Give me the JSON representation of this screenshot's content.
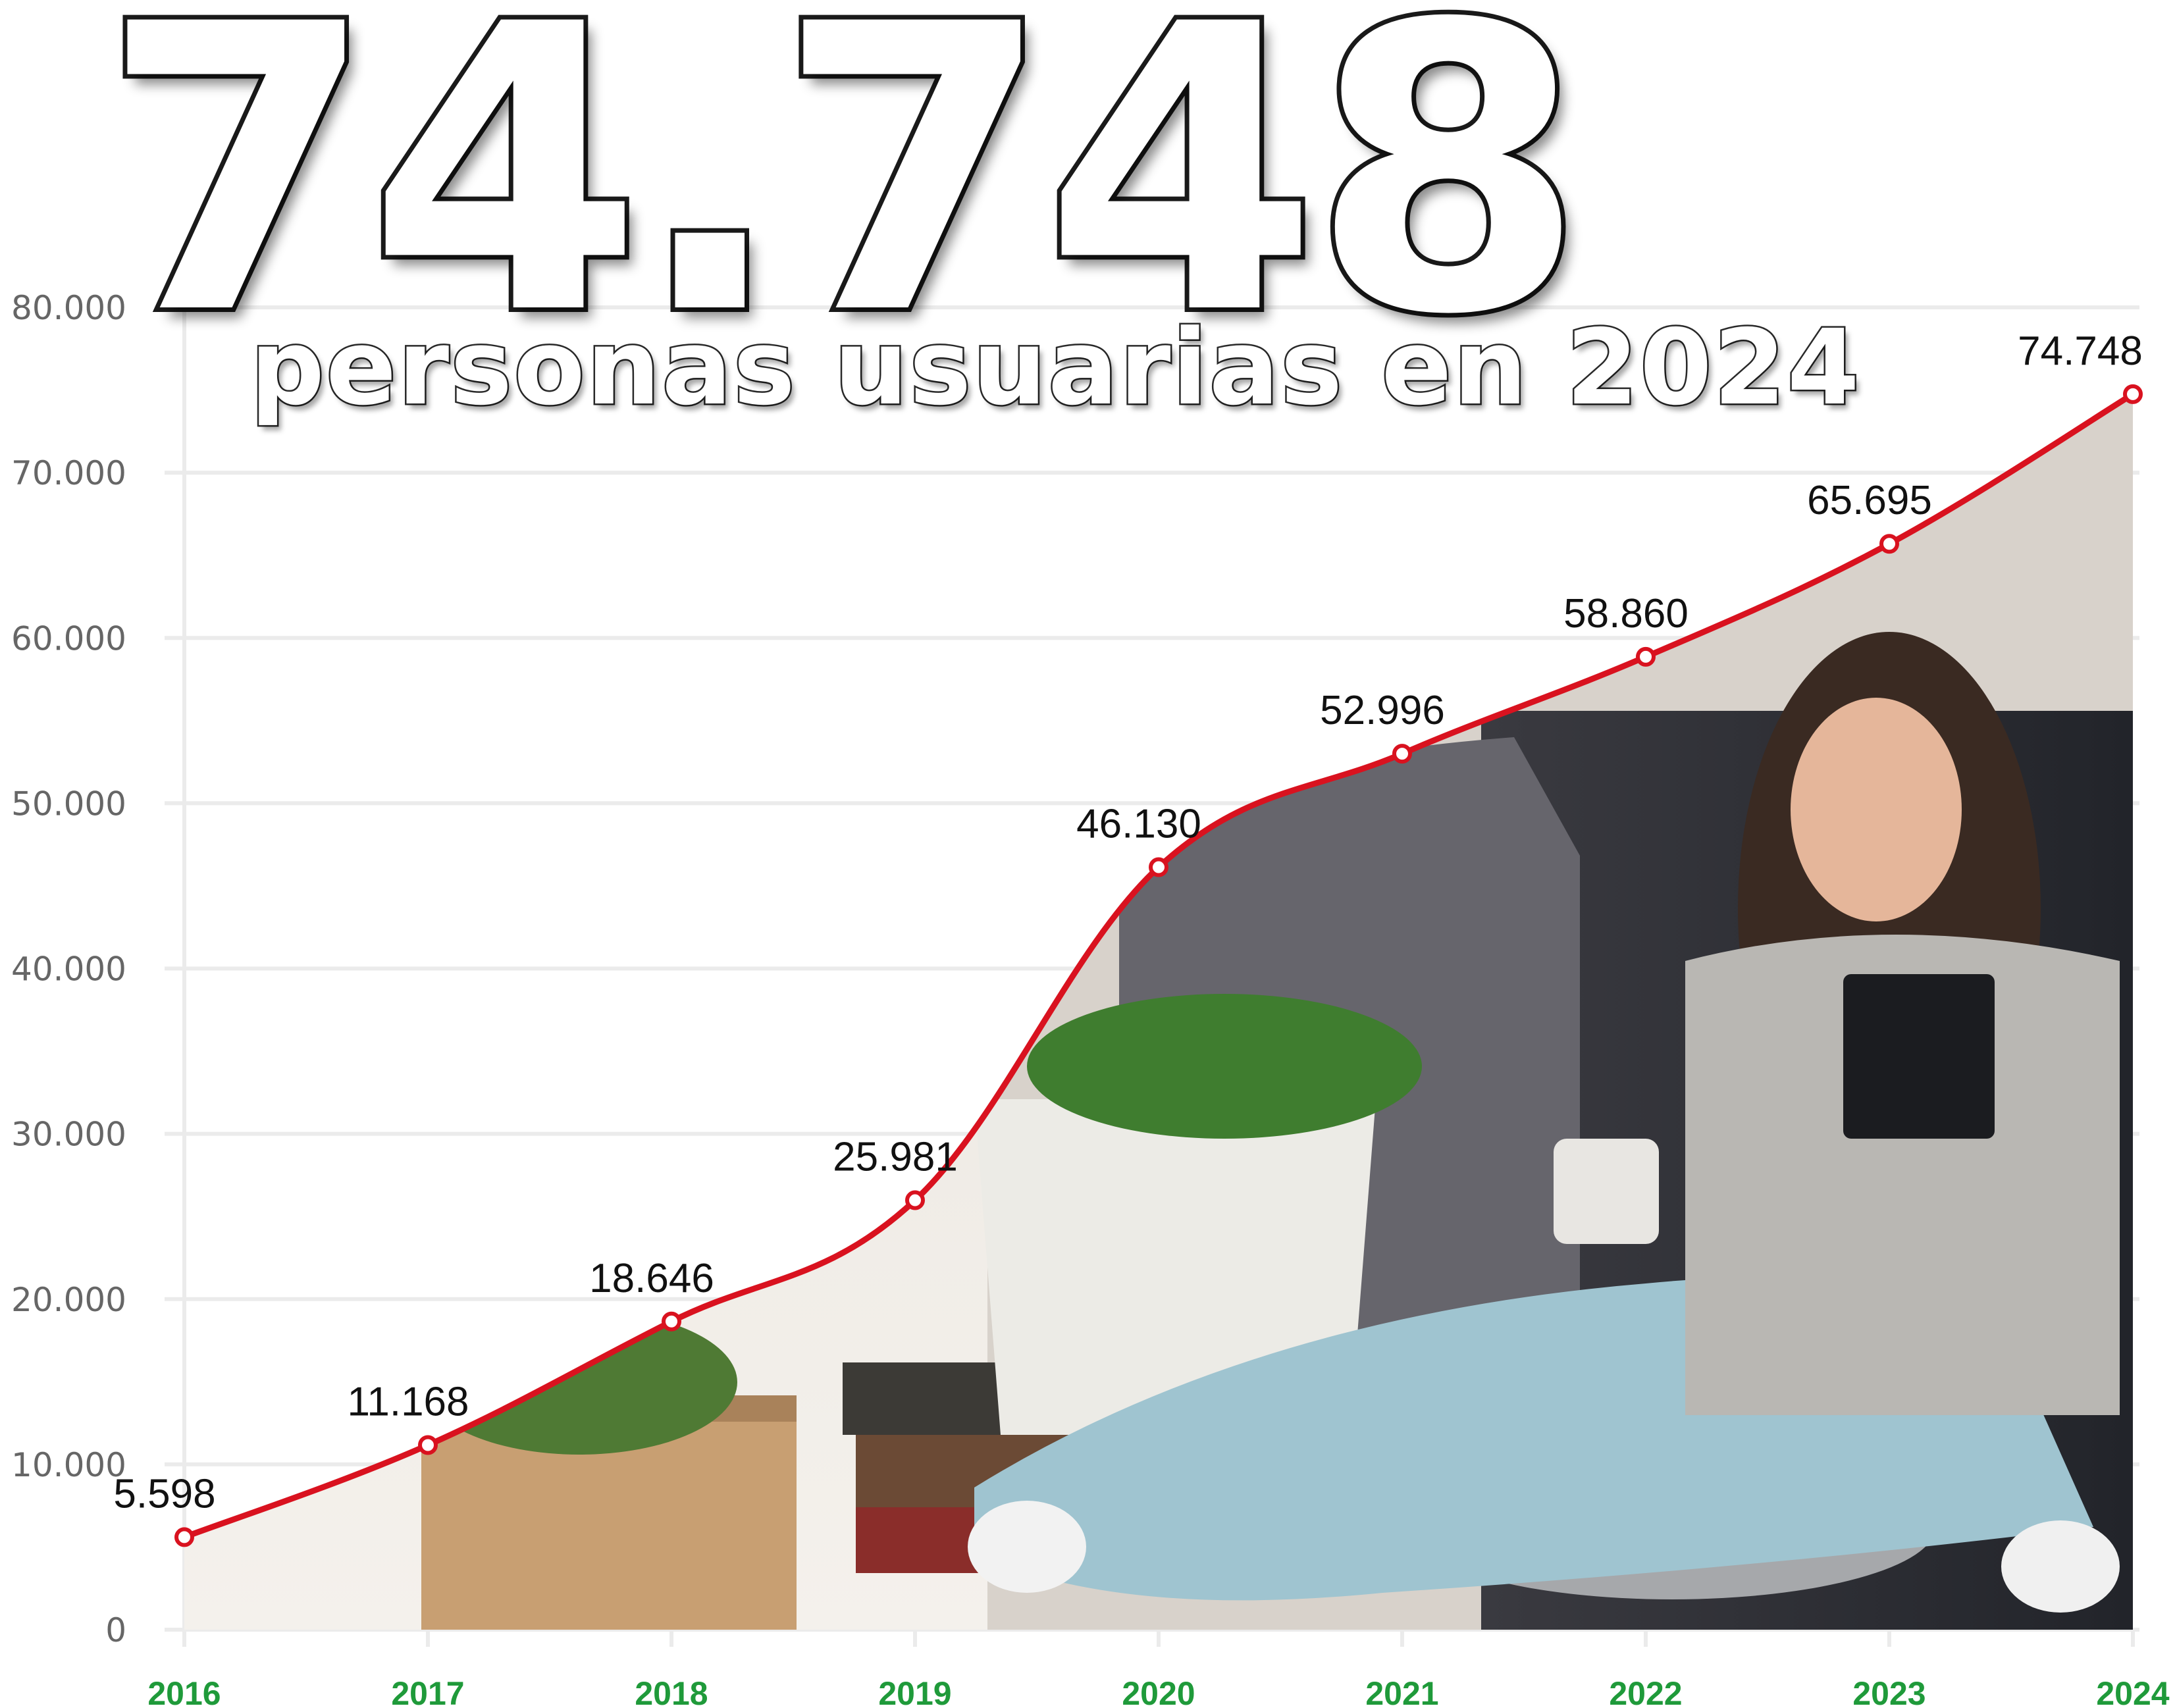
{
  "headline": {
    "number": "74.748",
    "subtitle": "personas usuarias en 2024"
  },
  "colors": {
    "line": "#d9121f",
    "x_tick": "#1f9a3a",
    "y_tick": "#666666",
    "grid": "#ebebeb",
    "value_label": "#111111"
  },
  "chart_data": {
    "type": "line",
    "categories": [
      "2016",
      "2017",
      "2018",
      "2019",
      "2020",
      "2021",
      "2022",
      "2023",
      "2024"
    ],
    "series": [
      {
        "values": [
          5598,
          11168,
          18646,
          25981,
          46130,
          52996,
          58860,
          65695,
          74748
        ],
        "labels": [
          "5.598",
          "11.168",
          "18.646",
          "25.981",
          "46.130",
          "52.996",
          "58.860",
          "65.695",
          "74.748"
        ]
      }
    ],
    "ylim": [
      0,
      80000
    ],
    "yticks": [
      0,
      10000,
      20000,
      30000,
      40000,
      50000,
      60000,
      70000,
      80000
    ],
    "ytick_labels": [
      "0",
      "10.000",
      "20.000",
      "30.000",
      "40.000",
      "50.000",
      "60.000",
      "70.000",
      "80.000"
    ],
    "grid": true,
    "legend": false
  }
}
